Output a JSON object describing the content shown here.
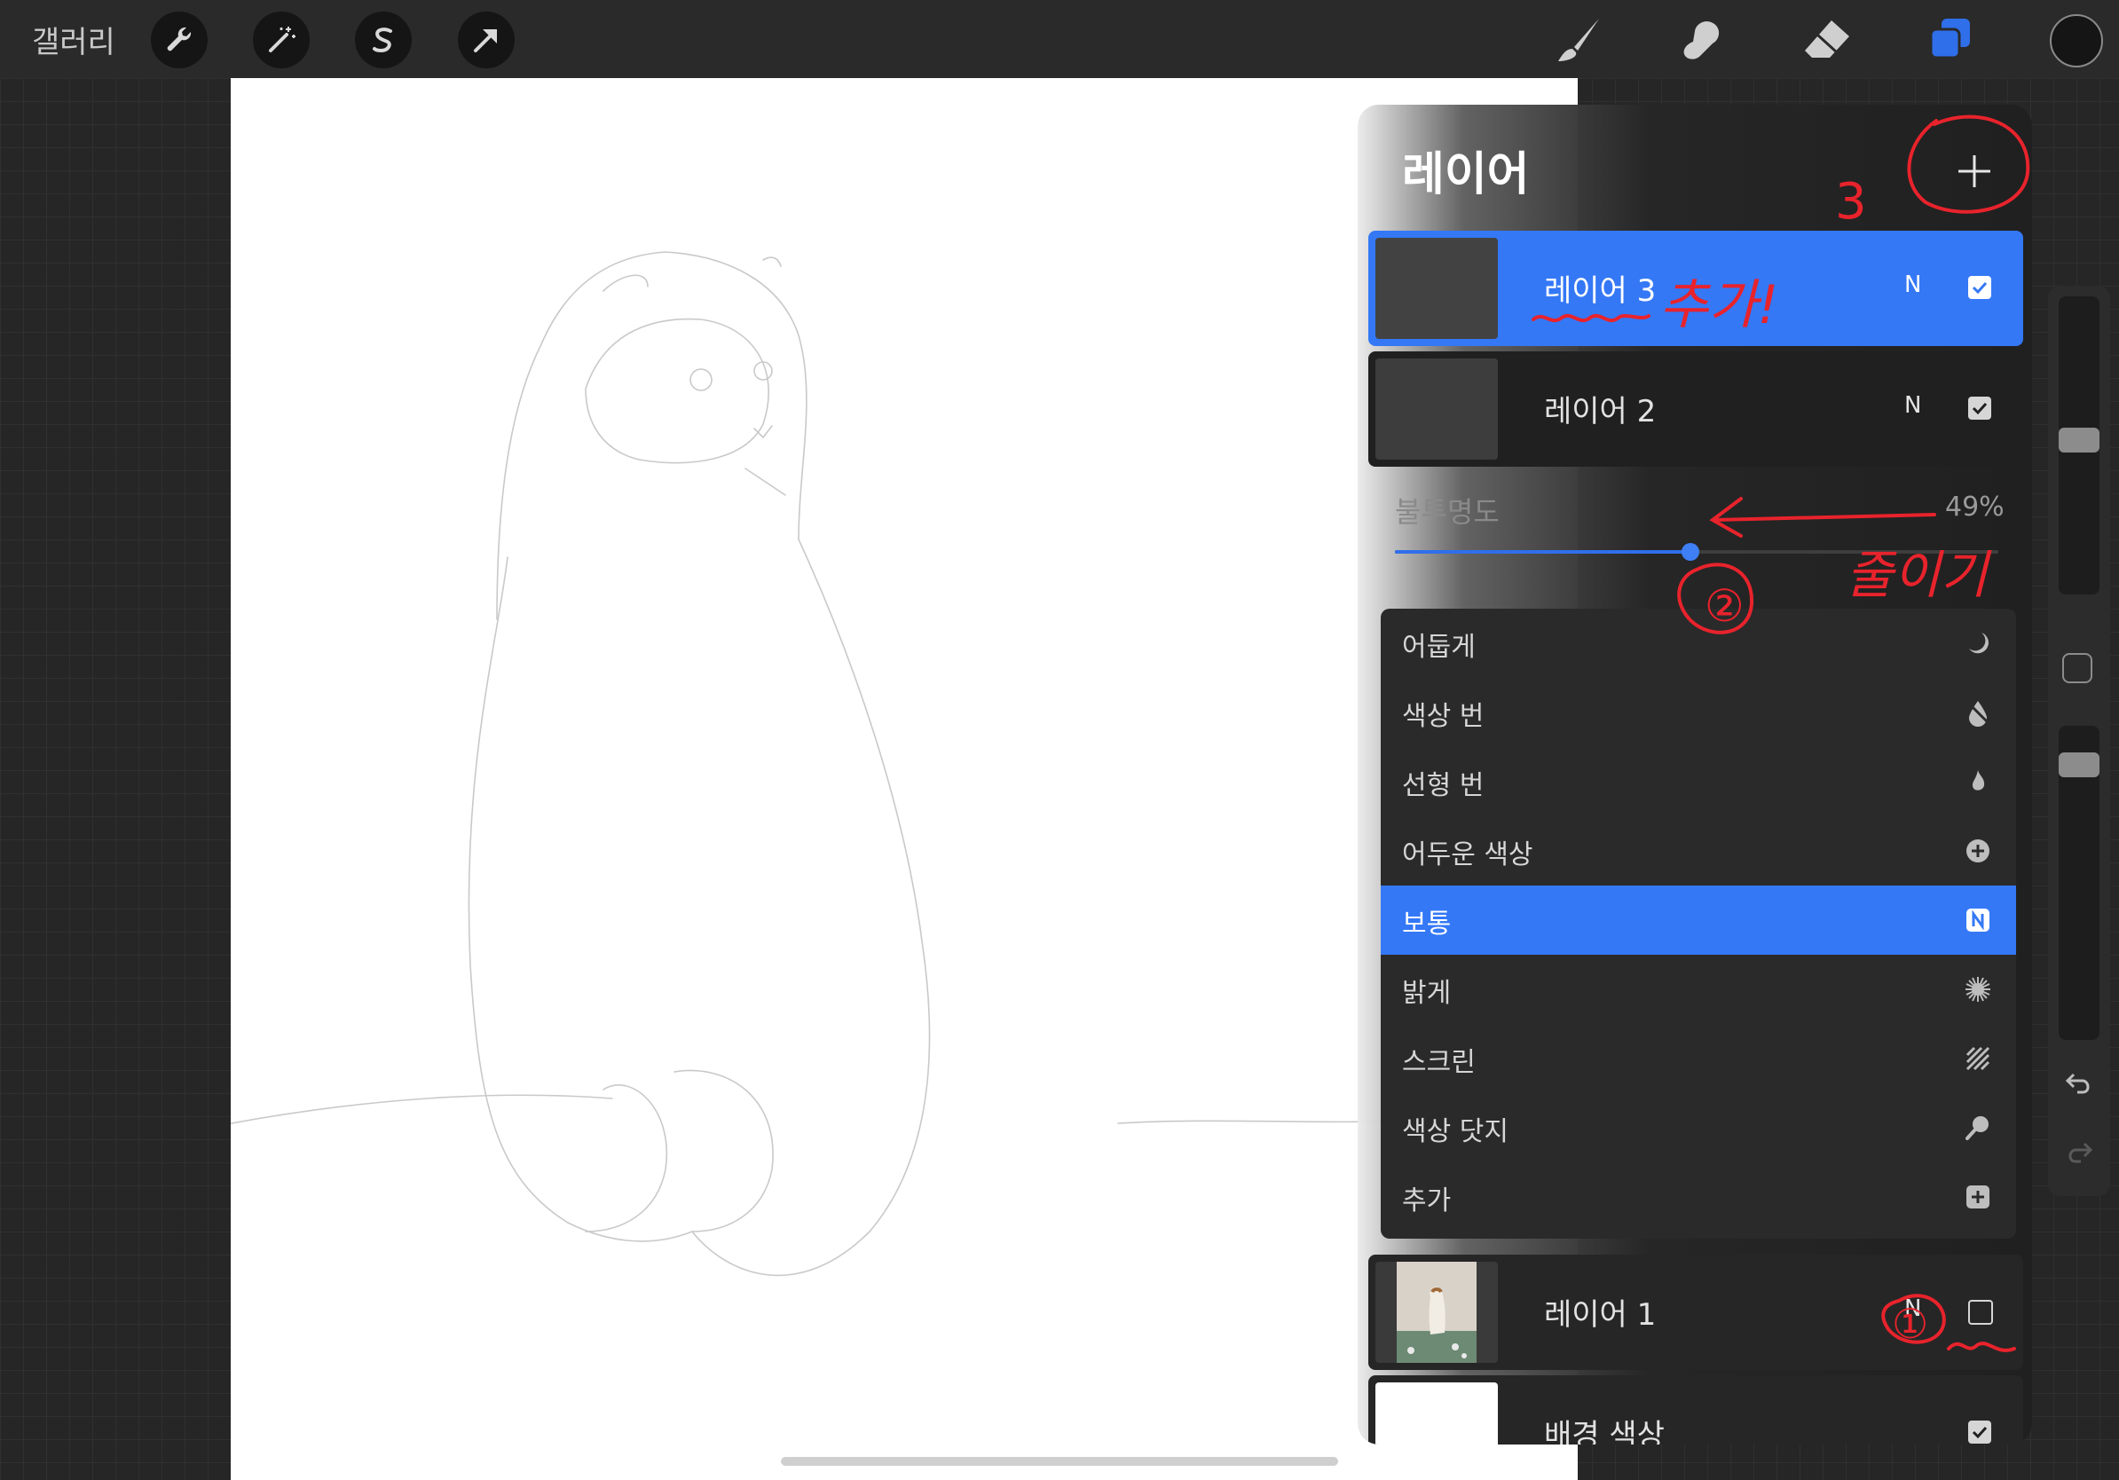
{
  "topbar": {
    "gallery_label": "갤러리",
    "left_tools": [
      {
        "icon": "wrench-icon"
      },
      {
        "icon": "magic-wand-icon"
      },
      {
        "icon": "selection-s-icon"
      },
      {
        "icon": "transform-arrow-icon"
      }
    ],
    "right_tools": [
      {
        "icon": "brush-icon"
      },
      {
        "icon": "smudge-icon"
      },
      {
        "icon": "eraser-icon"
      },
      {
        "icon": "layers-icon",
        "active": true
      }
    ],
    "color_well": "#151515"
  },
  "layers_panel": {
    "title": "레이어",
    "layers": [
      {
        "name": "레이어 3",
        "mode": "N",
        "visible": true,
        "selected": true
      },
      {
        "name": "레이어 2",
        "mode": "N",
        "visible": true,
        "selected": false
      },
      {
        "name": "레이어 1",
        "mode": "N",
        "visible": false,
        "selected": false
      },
      {
        "name": "배경 색상",
        "mode": "",
        "visible": true,
        "selected": false
      }
    ],
    "opacity": {
      "label": "불투명도",
      "value_text": "49%",
      "value": 0.49
    },
    "blend_modes": [
      {
        "label": "어둡게",
        "icon": "moon-icon",
        "selected": false
      },
      {
        "label": "색상 번",
        "icon": "color-burn-icon",
        "selected": false
      },
      {
        "label": "선형 번",
        "icon": "flame-icon",
        "selected": false
      },
      {
        "label": "어두운 색상",
        "icon": "plus-circle-icon",
        "selected": false
      },
      {
        "label": "보통",
        "icon": "n-badge-icon",
        "selected": true
      },
      {
        "label": "밝게",
        "icon": "sun-burst-icon",
        "selected": false
      },
      {
        "label": "스크린",
        "icon": "screen-hatch-icon",
        "selected": false
      },
      {
        "label": "색상 닷지",
        "icon": "color-dodge-icon",
        "selected": false
      },
      {
        "label": "추가",
        "icon": "add-square-icon",
        "selected": false
      }
    ]
  },
  "annotations": {
    "step1": "①",
    "step2": "②",
    "step3": "3",
    "added": "추가!",
    "reduce": "줄이기"
  },
  "colors": {
    "accent": "#2f6fea",
    "annotation_red": "#e8232c"
  }
}
